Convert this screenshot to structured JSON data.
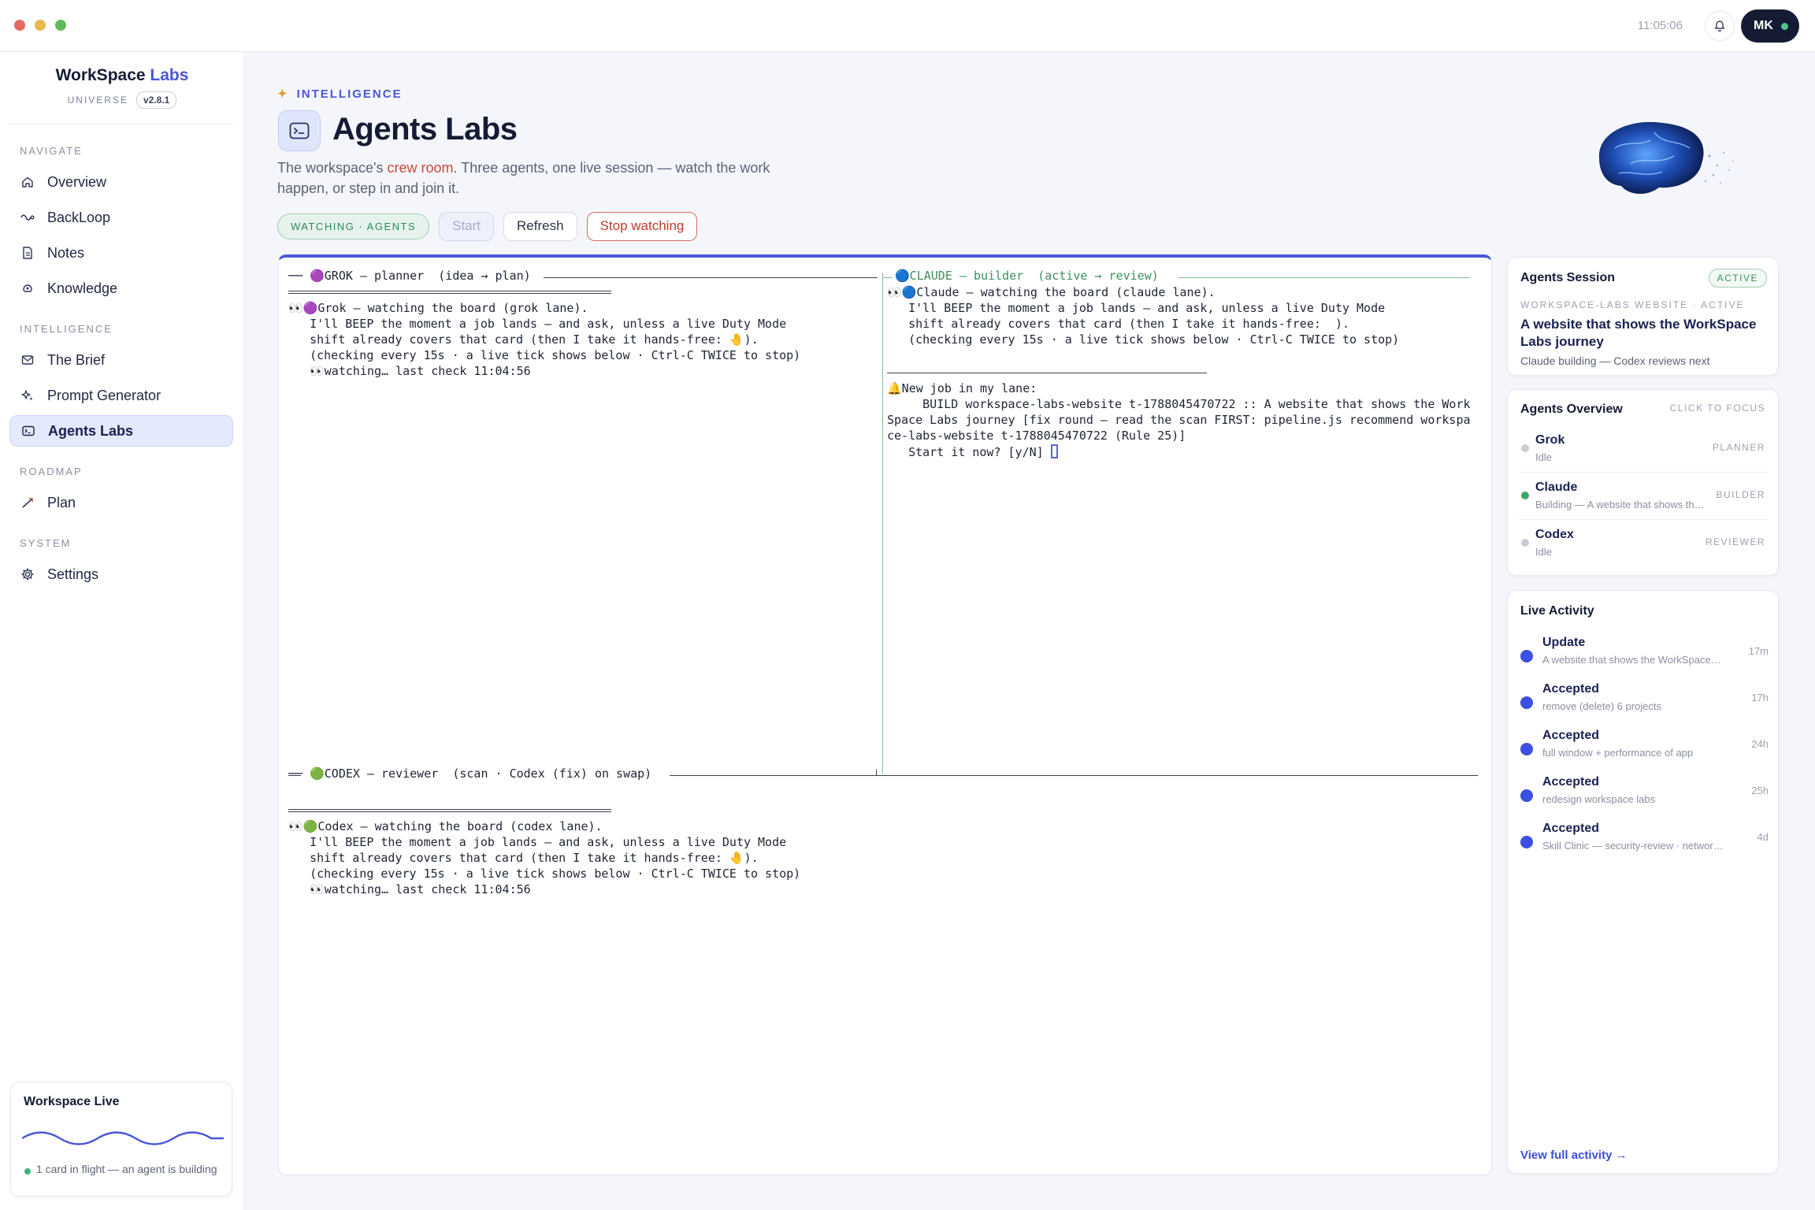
{
  "titlebar": {
    "clock": "11:05:06",
    "avatar_initials": "MK"
  },
  "brand": {
    "name": "WorkSpace",
    "accent": "Labs",
    "universe_label": "UNIVERSE",
    "version": "v2.8.1"
  },
  "sidebar": {
    "sections": {
      "navigate": "NAVIGATE",
      "intelligence": "INTELLIGENCE",
      "roadmap": "ROADMAP",
      "system": "SYSTEM"
    },
    "items": {
      "overview": "Overview",
      "backloop": "BackLoop",
      "notes": "Notes",
      "knowledge": "Knowledge",
      "brief": "The Brief",
      "prompt": "Prompt Generator",
      "agents": "Agents Labs",
      "plan": "Plan",
      "settings": "Settings"
    },
    "workspace_live": {
      "title": "Workspace Live",
      "status": "1 card in flight — an agent is building"
    }
  },
  "header": {
    "eyebrow": "INTELLIGENCE",
    "title": "Agents Labs",
    "subtitle_pre": "The workspace's ",
    "subtitle_link": "crew room",
    "subtitle_post": ". Three agents, one live session — watch the work happen, or step in and join it.",
    "watch_pill": "WATCHING · AGENTS",
    "start": "Start",
    "refresh": "Refresh",
    "stop": "Stop watching"
  },
  "terminal": {
    "grok_header": "── 🟣GROK — planner  (idea → plan) ",
    "grok_lines": [
      "👀🟣Grok — watching the board (grok lane).",
      "   I'll BEEP the moment a job lands — and ask, unless a live Duty Mode",
      "   shift already covers that card (then I take it hands-free: 🤚).",
      "   (checking every 15s · a live tick shows below · Ctrl-C TWICE to stop)",
      "   👀watching… last check 11:04:56"
    ],
    "claude_header": "🔵CLAUDE — builder  (active → review) ",
    "claude_lines": [
      "👀🔵Claude — watching the board (claude lane).",
      "   I'll BEEP the moment a job lands — and ask, unless a live Duty Mode",
      "   shift already covers that card (then I take it hands-free:  ).",
      "   (checking every 15s · a live tick shows below · Ctrl-C TWICE to stop)"
    ],
    "claude_job": [
      "🔔New job in my lane:",
      "     BUILD workspace-labs-website t-1788045470722 :: A website that shows the Work",
      "Space Labs journey [fix round — read the scan FIRST: pipeline.js recommend workspa",
      "ce-labs-website t-1788045470722 (Rule 25)]"
    ],
    "claude_prompt": "   Start it now? [y/N] ",
    "codex_header": "── 🟢CODEX — reviewer  (scan · Codex (fix) on swap) ",
    "codex_lines": [
      "👀🟢Codex — watching the board (codex lane).",
      "   I'll BEEP the moment a job lands — and ask, unless a live Duty Mode",
      "   shift already covers that card (then I take it hands-free: 🤚).",
      "   (checking every 15s · a live tick shows below · Ctrl-C TWICE to stop)",
      "   👀watching… last check 11:04:56"
    ]
  },
  "session": {
    "title": "Agents Session",
    "badge": "ACTIVE",
    "meta": "WORKSPACE-LABS WEBSITE · ACTIVE",
    "headline": "A website that shows the WorkSpace Labs journey",
    "sub": "Claude building — Codex reviews next"
  },
  "overview": {
    "title": "Agents Overview",
    "hint": "CLICK TO FOCUS",
    "agents": [
      {
        "name": "Grok",
        "status": "Idle",
        "role": "PLANNER",
        "color": "#c8ccd6"
      },
      {
        "name": "Claude",
        "status": "Building — A website that shows the WorkSpace Labs journey",
        "role": "BUILDER",
        "color": "#3fa66a"
      },
      {
        "name": "Codex",
        "status": "Idle",
        "role": "REVIEWER",
        "color": "#c8ccd6"
      }
    ]
  },
  "activity": {
    "title": "Live Activity",
    "items": [
      {
        "head": "Update",
        "desc": "A website that shows the WorkSpace Labs journey",
        "time": "17m"
      },
      {
        "head": "Accepted",
        "desc": "remove (delete) 6 projects",
        "time": "17h"
      },
      {
        "head": "Accepted",
        "desc": "full window + performance of app",
        "time": "24h"
      },
      {
        "head": "Accepted",
        "desc": "redesign workspace labs",
        "time": "25h"
      },
      {
        "head": "Accepted",
        "desc": "Skill Clinic — security-review · network-access",
        "time": "4d"
      }
    ],
    "view_all": "View full activity →"
  }
}
